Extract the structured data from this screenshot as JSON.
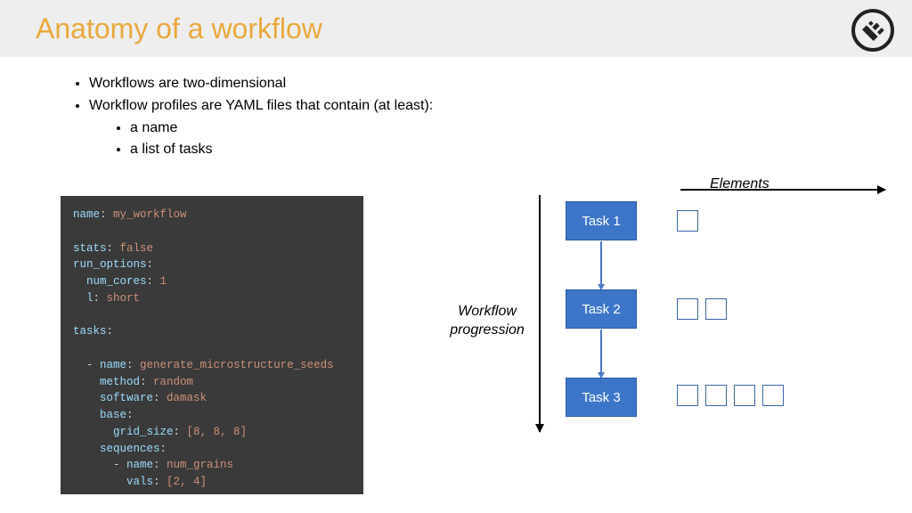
{
  "title": "Anatomy of a workflow",
  "bullets": {
    "b1": "Workflows are two-dimensional",
    "b2": "Workflow profiles are YAML files that contain (at least):",
    "b2a": "a name",
    "b2b": "a list of tasks"
  },
  "code": {
    "l1k": "name",
    "l1v": "my_workflow",
    "l2k": "stats",
    "l2v": "false",
    "l3k": "run_options",
    "l4k": "num_cores",
    "l4v": "1",
    "l5k": "l",
    "l5v": "short",
    "l6k": "tasks",
    "l7k": "name",
    "l7v": "generate_microstructure_seeds",
    "l8k": "method",
    "l8v": "random",
    "l9k": "software",
    "l9v": "damask",
    "l10k": "base",
    "l11k": "grid_size",
    "l11v": "[8, 8, 8]",
    "l12k": "sequences",
    "l13k": "name",
    "l13v": "num_grains",
    "l14k": "vals",
    "l14v": "[2, 4]"
  },
  "diagram": {
    "elements_label": "Elements",
    "progression_label": "Workflow progression",
    "task1": "Task 1",
    "task2": "Task 2",
    "task3": "Task 3",
    "element_counts": [
      1,
      2,
      4
    ]
  }
}
